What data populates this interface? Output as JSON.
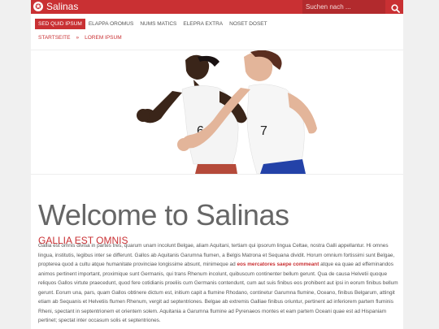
{
  "header": {
    "site_title": "Salinas",
    "search_placeholder": "Suchen nach ...",
    "logo_icon": "star-circle-icon",
    "search_icon": "search-icon"
  },
  "nav": {
    "items": [
      {
        "label": "Sed quid ipsum",
        "active": true
      },
      {
        "label": "Elappa oromus",
        "active": false
      },
      {
        "label": "Nums matics",
        "active": false
      },
      {
        "label": "Elepra extra",
        "active": false
      },
      {
        "label": "Noset doset",
        "active": false
      }
    ]
  },
  "breadcrumb": {
    "home": "Startseite",
    "separator": "»",
    "current": "Lorem ipsum"
  },
  "hero": {
    "runner_left_number": "6",
    "runner_right_number": "7"
  },
  "content": {
    "title": "Welcome to Salinas",
    "subtitle": "Gallia est omnis",
    "paragraph_before_link": "Gallia est omnis divisa in partes tres, quarum unam incolunt Belgae, aliam Aquitani, tertiam qui ipsorum lingua Celtae, nostra Galli appellantur. Hi omnes lingua, institutis, legibus inter se differunt. Gallos ab Aquitanis Garumna flumen, a Belgis Matrona et Sequana dividit. Horum omnium fortissimi sunt Belgae, propterea quod a cultu atque humanitate provinciae longissime absunt, minimeque ad",
    "link_text": "eos mercatores saepe commeant",
    "paragraph_after_link": "atque ea quae ad effeminandos animos pertinent important, proximique sunt Germanis, qui trans Rhenum incolunt, quibuscum continenter bellum gerunt. Qua de causa Helvetii quoque reliquos Gallos virtute praecedunt, quod fere cotidianis proeliis cum Germanis contendunt, cum aut suis finibus eos prohibent aut ipsi in eorum finibus bellum gerunt. Eorum una, pars, quam Gallos obtinere dictum est, initium capit a flumine Rhodano, continetur Garumna flumine, Oceano, finibus Belgarum, attingit etiam ab Sequanis et Helvetiis flumen Rhenum, vergit ad septentriones. Belgae ab extremis Galliae finibus oriuntur, pertinent ad inferiorem partem fluminis Rheni, spectant in septentrionem et orientem solem. Aquitania a Garumna flumine ad Pyrenaeos montes et eam partem Oceani quae est ad Hispaniam pertinet; spectat inter occasum solis et septentriones."
  },
  "colors": {
    "accent": "#c93033",
    "background": "#f0f0f0",
    "text": "#555555"
  }
}
